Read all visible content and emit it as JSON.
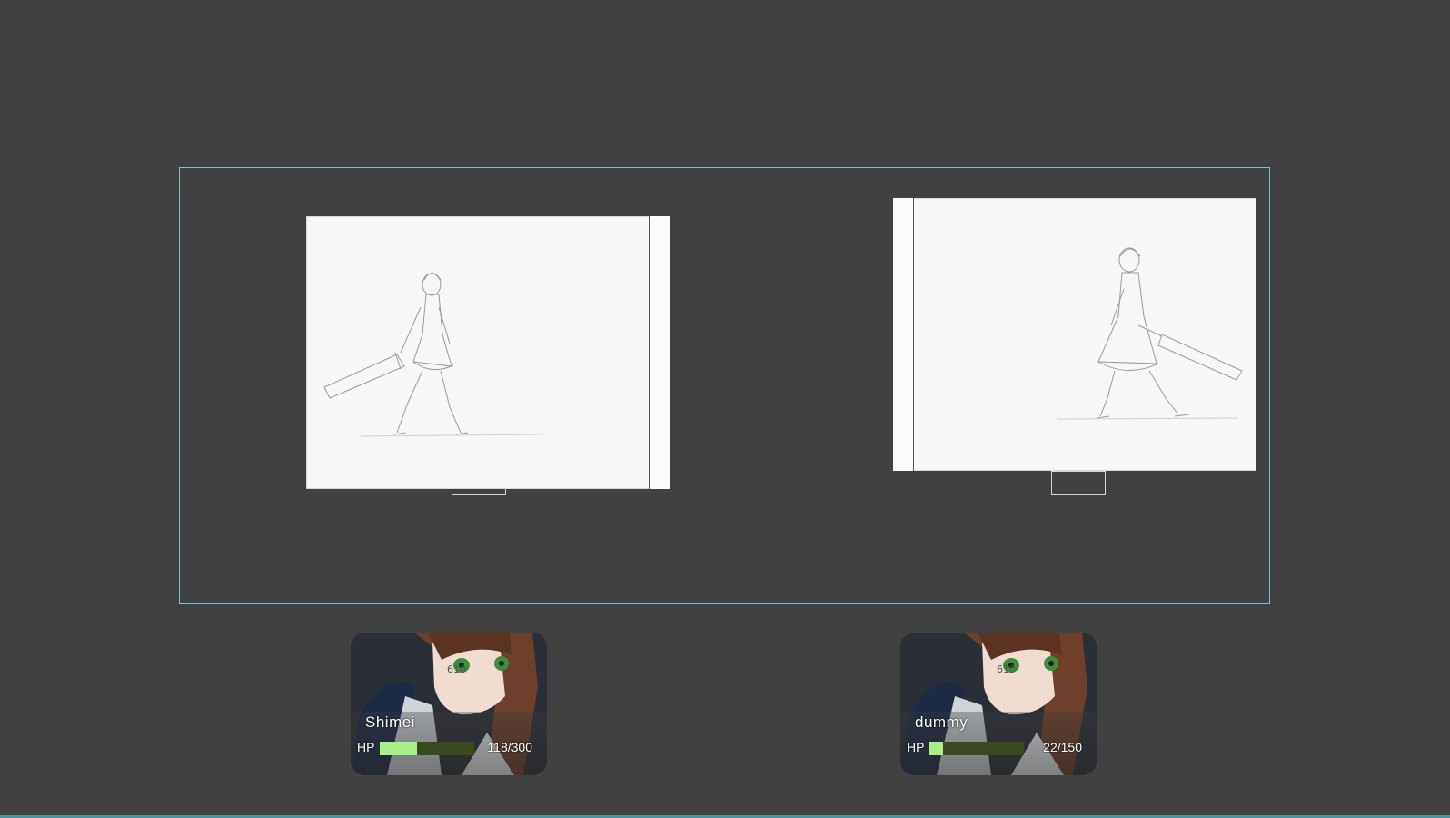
{
  "party": [
    {
      "name": "Shimei",
      "hp_label": "HP",
      "hp_current": 118,
      "hp_max": 300,
      "hp_text": "118/300",
      "hp_fill_fraction": 0.393
    },
    {
      "name": "dummy",
      "hp_label": "HP",
      "hp_current": 22,
      "hp_max": 150,
      "hp_text": "22/150",
      "hp_fill_fraction": 0.147
    }
  ],
  "colors": {
    "background": "#414141",
    "arena_border": "#6fc6cf",
    "hp_fill": "#a9ef87",
    "hp_track": "#3b4a1e"
  },
  "icons": {
    "left_sprite": "sword-girl-sketch-icon",
    "right_sprite": "sword-girl-sketch-icon",
    "portrait": "character-portrait-icon"
  }
}
